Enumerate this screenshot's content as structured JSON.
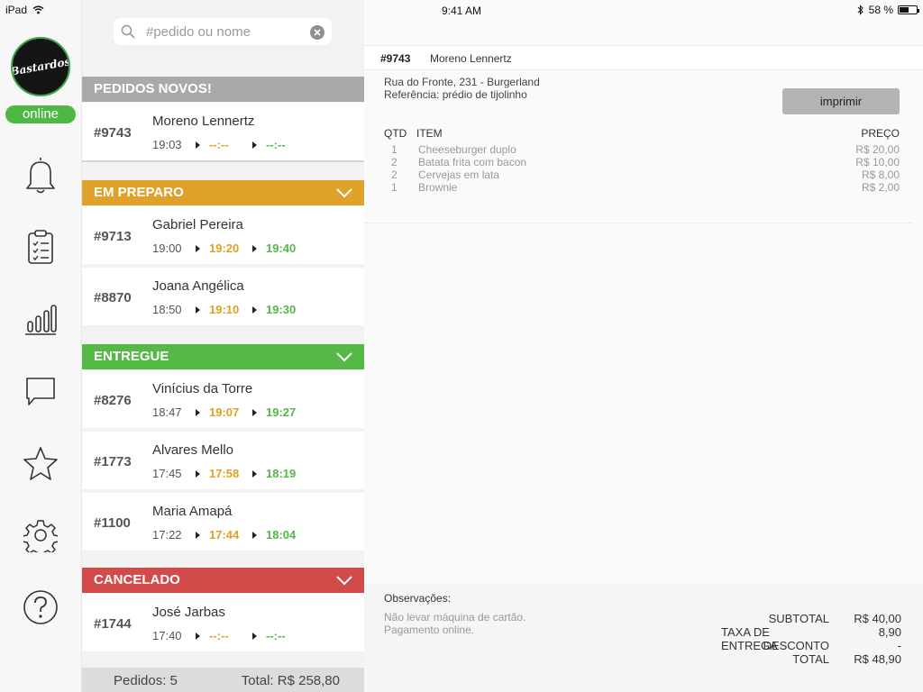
{
  "status_bar": {
    "device": "iPad",
    "time": "9:41 AM",
    "battery_text": "58 %",
    "battery_level": 0.58
  },
  "sidebar": {
    "logo_text": "Bastardos",
    "status_badge": "online",
    "nav": [
      "bell-icon",
      "clipboard-icon",
      "chart-icon",
      "chat-icon",
      "star-icon",
      "gear-icon",
      "help-icon"
    ]
  },
  "search": {
    "placeholder": "#pedido ou nome",
    "value": ""
  },
  "sections": {
    "novos": {
      "title": "PEDIDOS NOVOS!",
      "color": "#a9a9a9"
    },
    "preparo": {
      "title": "EM PREPARO",
      "color": "#e0a12b"
    },
    "entregue": {
      "title": "ENTREGUE",
      "color": "#56b947"
    },
    "cancelado": {
      "title": "CANCELADO",
      "color": "#d24b4b"
    }
  },
  "orders": {
    "novos": [
      {
        "num": "#9743",
        "name": "Moreno Lennertz",
        "t1": "19:03",
        "t2": "--:--",
        "t3": "--:--"
      }
    ],
    "preparo": [
      {
        "num": "#9713",
        "name": "Gabriel Pereira",
        "t1": "19:00",
        "t2": "19:20",
        "t3": "19:40"
      },
      {
        "num": "#8870",
        "name": "Joana Angélica",
        "t1": "18:50",
        "t2": "19:10",
        "t3": "19:30"
      }
    ],
    "entregue": [
      {
        "num": "#8276",
        "name": "Vinícius da Torre",
        "t1": "18:47",
        "t2": "19:07",
        "t3": "19:27"
      },
      {
        "num": "#1773",
        "name": "Alvares Mello",
        "t1": "17:45",
        "t2": "17:58",
        "t3": "18:19"
      },
      {
        "num": "#1100",
        "name": "Maria Amapá",
        "t1": "17:22",
        "t2": "17:44",
        "t3": "18:04"
      }
    ],
    "cancelado": [
      {
        "num": "#1744",
        "name": "José Jarbas",
        "t1": "17:40",
        "t2": "--:--",
        "t3": "--:--"
      }
    ]
  },
  "footer": {
    "count": "Pedidos: 5",
    "total": "Total: R$ 258,80"
  },
  "detail": {
    "num": "#9743",
    "name": "Moreno Lennertz",
    "address": "Rua do Fronte, 231 - Burgerland",
    "reference": "Referência: prédio de tijolinho",
    "print_label": "imprimir",
    "col_qtd": "QTD",
    "col_item": "ITEM",
    "col_price": "PREÇO",
    "items": [
      {
        "qtd": "1",
        "name": "Cheeseburger duplo",
        "price": "R$ 20,00"
      },
      {
        "qtd": "2",
        "name": "Batata frita com bacon",
        "price": "R$ 10,00"
      },
      {
        "qtd": "2",
        "name": "Cervejas em lata",
        "price": "R$ 8,00"
      },
      {
        "qtd": "1",
        "name": "Brownie",
        "price": "R$ 2,00"
      }
    ],
    "obs_title": "Observações:",
    "obs_line1": "Não levar máquina de cartão.",
    "obs_line2": "Pagamento online.",
    "totals": [
      {
        "label": "SUBTOTAL",
        "value": "R$ 40,00"
      },
      {
        "label": "TAXA DE ENTREGA",
        "value": "8,90"
      },
      {
        "label": "DESCONTO",
        "value": "-"
      },
      {
        "label": "TOTAL",
        "value": "R$ 48,90"
      }
    ]
  }
}
